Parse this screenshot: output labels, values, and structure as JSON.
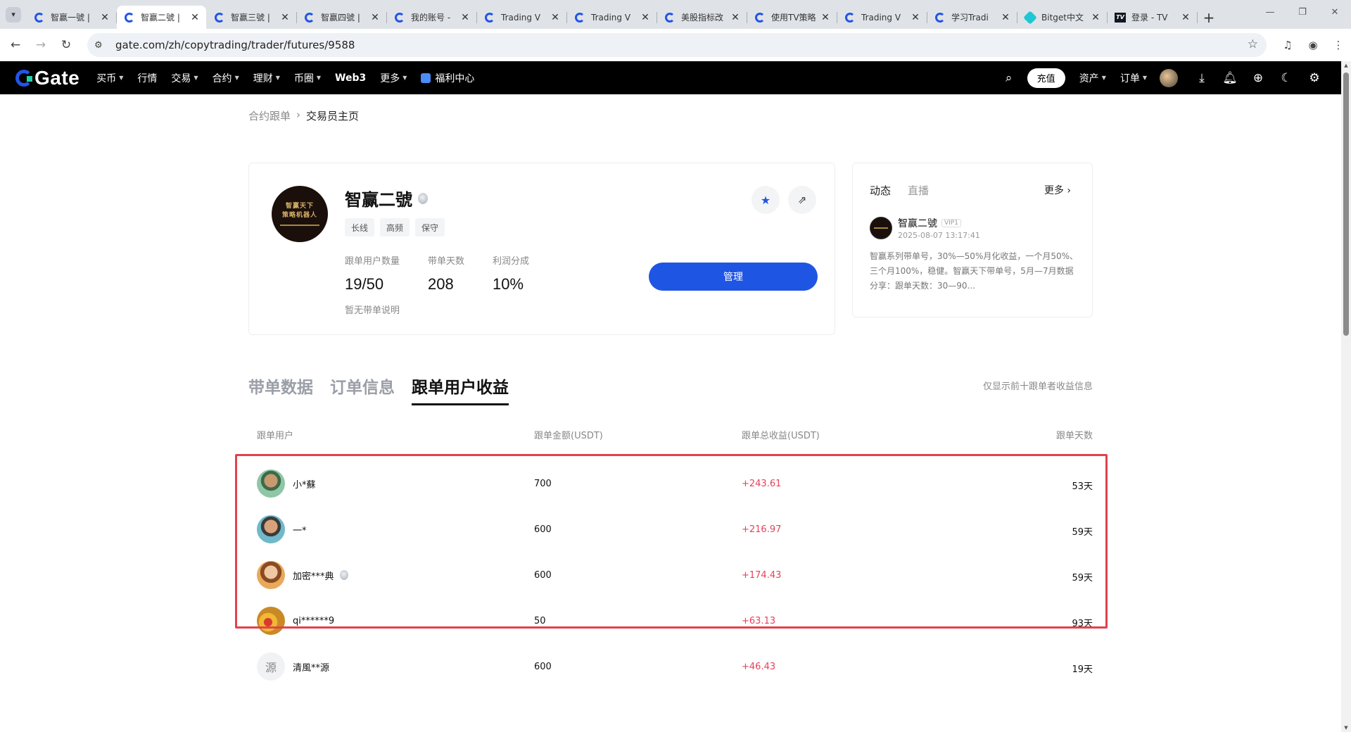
{
  "browser": {
    "tabs": [
      {
        "title": "智赢一號 |",
        "icon": "gate-favicon",
        "active": false
      },
      {
        "title": "智赢二號 |",
        "icon": "gate-favicon",
        "active": true
      },
      {
        "title": "智赢三號 |",
        "icon": "gate-favicon",
        "active": false
      },
      {
        "title": "智赢四號 |",
        "icon": "gate-favicon",
        "active": false
      },
      {
        "title": "我的账号 -",
        "icon": "gate-favicon",
        "active": false
      },
      {
        "title": "Trading V",
        "icon": "gate-favicon",
        "active": false
      },
      {
        "title": "Trading V",
        "icon": "gate-favicon",
        "active": false
      },
      {
        "title": "美股指标改",
        "icon": "gate-favicon",
        "active": false
      },
      {
        "title": "使用TV策略",
        "icon": "gate-favicon",
        "active": false
      },
      {
        "title": "Trading V",
        "icon": "gate-favicon",
        "active": false
      },
      {
        "title": "学习Tradi",
        "icon": "gate-favicon",
        "active": false
      },
      {
        "title": "Bitget中文",
        "icon": "bitget-favicon",
        "active": false
      },
      {
        "title": "登录 - TV",
        "icon": "tradingview-favicon",
        "active": false
      }
    ],
    "url": "gate.com/zh/copytrading/trader/futures/9588"
  },
  "nav": {
    "logo": "Gate",
    "menu": [
      {
        "label": "买币",
        "dropdown": true
      },
      {
        "label": "行情",
        "dropdown": false
      },
      {
        "label": "交易",
        "dropdown": true
      },
      {
        "label": "合约",
        "dropdown": true
      },
      {
        "label": "理财",
        "dropdown": true
      },
      {
        "label": "币圈",
        "dropdown": true
      },
      {
        "label": "Web3",
        "dropdown": false
      },
      {
        "label": "更多",
        "dropdown": true
      }
    ],
    "welfare": "福利中心",
    "deposit": "充值",
    "assets": "资产",
    "orders": "订单"
  },
  "breadcrumb": {
    "parent": "合约跟单",
    "current": "交易员主页"
  },
  "profile": {
    "name": "智赢二號",
    "avatar_line1": "智赢天下",
    "avatar_line2": "策略机器人",
    "tags": [
      "长线",
      "高频",
      "保守"
    ],
    "stats": [
      {
        "label": "跟单用户数量",
        "value": "19/50"
      },
      {
        "label": "带单天数",
        "value": "208"
      },
      {
        "label": "利润分成",
        "value": "10%"
      }
    ],
    "description": "暂无带单说明",
    "manage": "管理"
  },
  "feed": {
    "tabs": [
      "动态",
      "直播"
    ],
    "more": "更多",
    "post": {
      "name": "智赢二號",
      "vip": "VIP1",
      "time": "2025-08-07 13:17:41",
      "text": "智赢系列带单号，30%—50%月化收益，一个月50%、三个月100%，稳健。智赢天下带单号，5月—7月数据分享：跟单天数：30—90..."
    }
  },
  "tabs": {
    "items": [
      "带单数据",
      "订单信息",
      "跟单用户收益"
    ],
    "active_index": 2,
    "note": "仅显示前十跟单者收益信息"
  },
  "table": {
    "headers": {
      "user": "跟单用户",
      "amount": "跟单金额(USDT)",
      "pnl": "跟单总收益(USDT)",
      "days": "跟单天数"
    },
    "rows": [
      {
        "user": "小*蘇",
        "amount": "700",
        "pnl": "+243.61",
        "days": "53天",
        "medal": false
      },
      {
        "user": "一*",
        "amount": "600",
        "pnl": "+216.97",
        "days": "59天",
        "medal": false
      },
      {
        "user": "加密***典",
        "amount": "600",
        "pnl": "+174.43",
        "days": "59天",
        "medal": true
      },
      {
        "user": "qi******9",
        "amount": "50",
        "pnl": "+63.13",
        "days": "93天",
        "medal": false
      },
      {
        "user": "清風**源",
        "amount": "600",
        "pnl": "+46.43",
        "days": "19天",
        "medal": false,
        "avatar_text": "源"
      }
    ]
  },
  "colors": {
    "accent": "#1e55e3",
    "profit": "#e8405c",
    "highlight": "#e1434d"
  }
}
